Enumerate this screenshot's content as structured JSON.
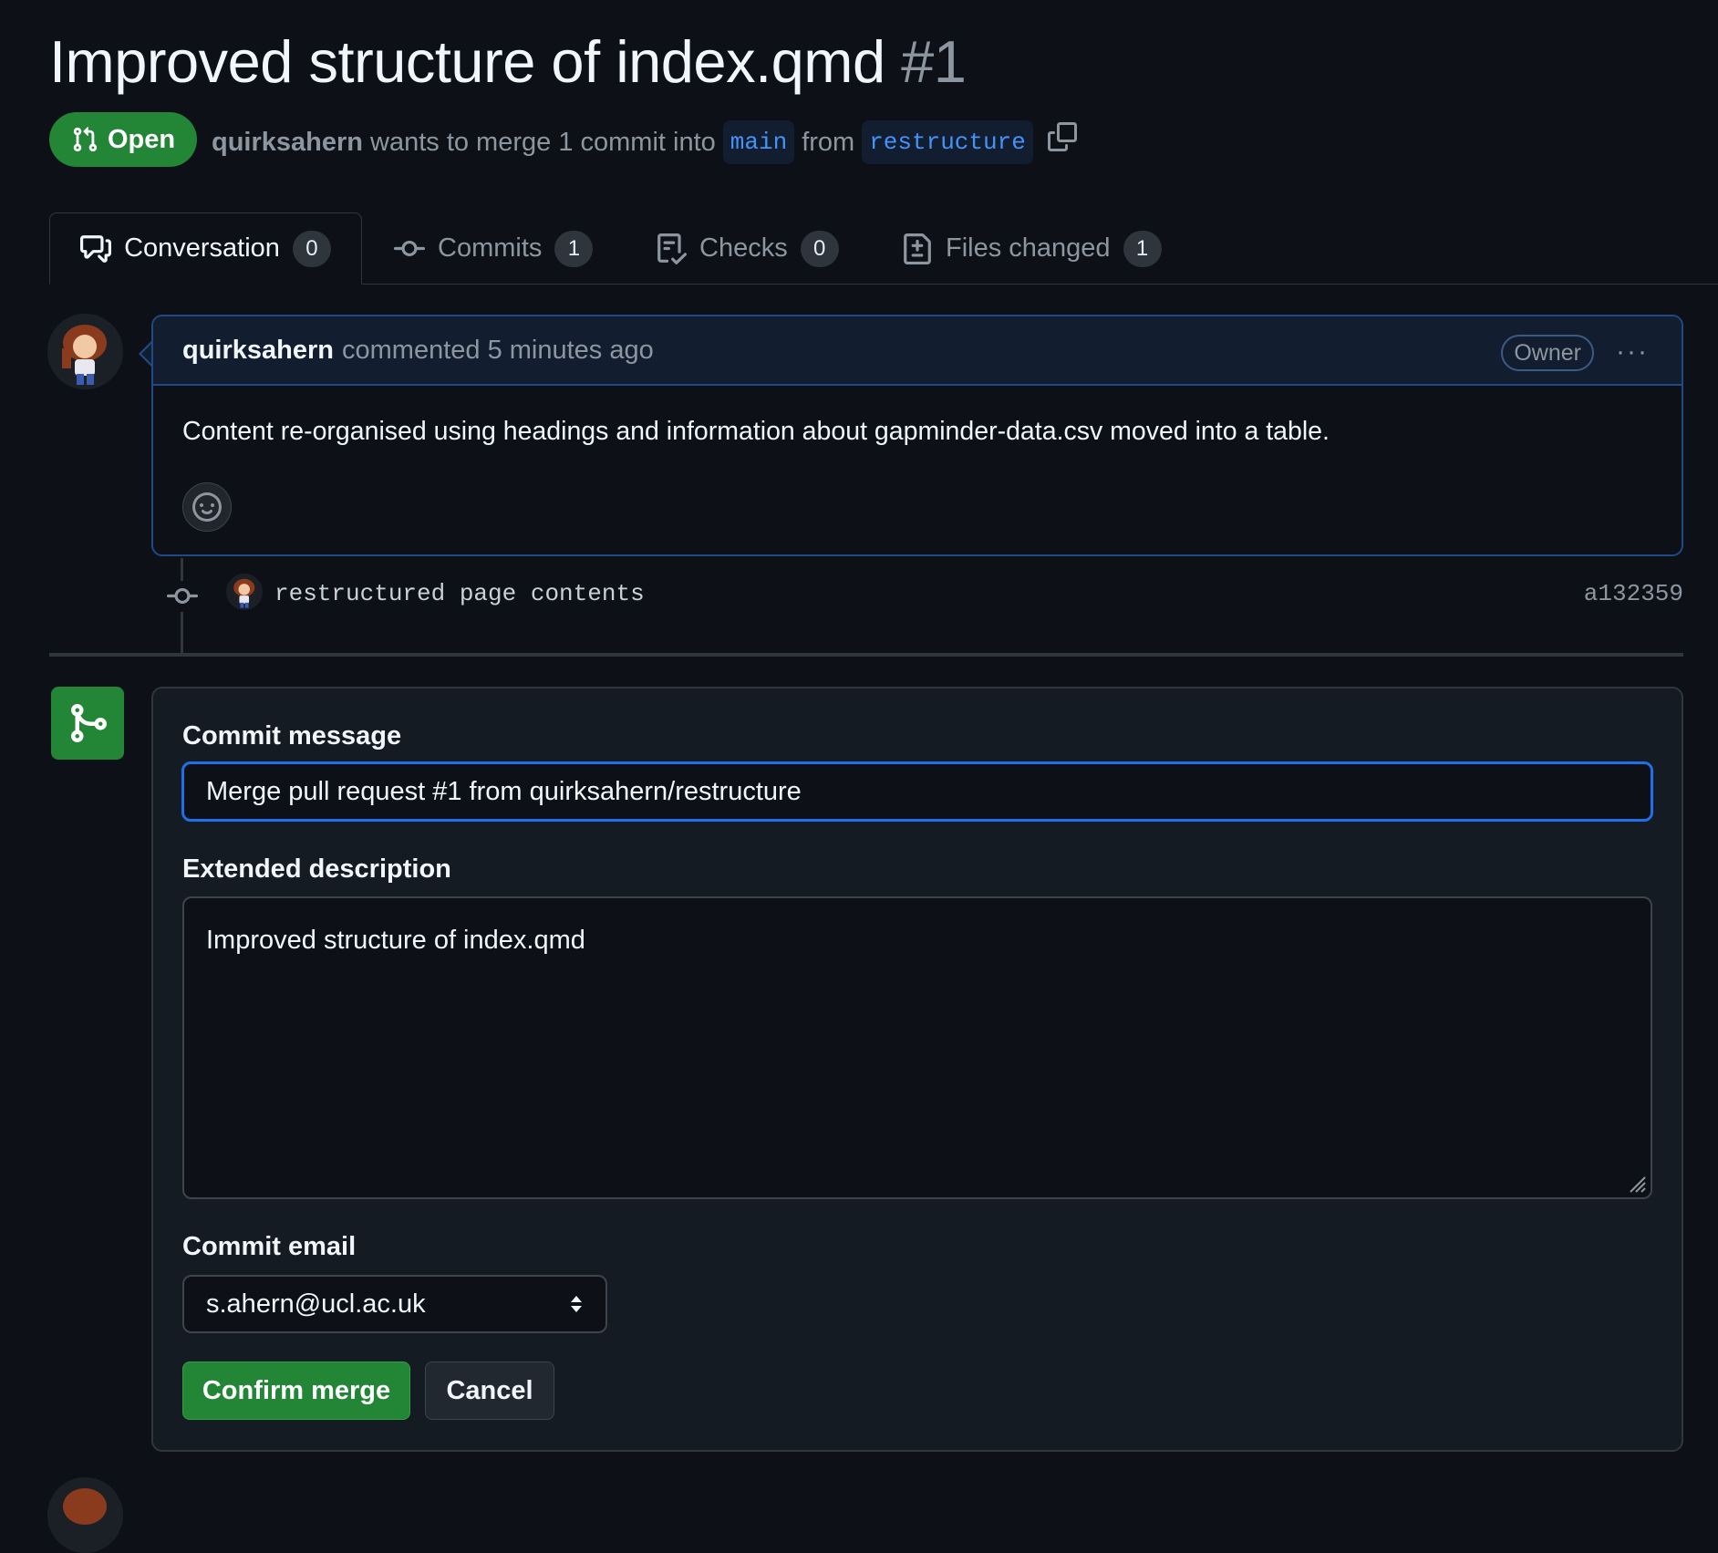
{
  "pr": {
    "title": "Improved structure of index.qmd",
    "number": "#1",
    "state": "Open",
    "author": "quirksahern",
    "meta_text": "wants to merge 1 commit into",
    "base_branch": "main",
    "from_text": "from",
    "head_branch": "restructure"
  },
  "tabs": [
    {
      "label": "Conversation",
      "count": "0",
      "icon": "comment-discussion-icon"
    },
    {
      "label": "Commits",
      "count": "1",
      "icon": "git-commit-icon"
    },
    {
      "label": "Checks",
      "count": "0",
      "icon": "checklist-icon"
    },
    {
      "label": "Files changed",
      "count": "1",
      "icon": "file-diff-icon"
    }
  ],
  "comment": {
    "author": "quirksahern",
    "action": "commented 5 minutes ago",
    "badge": "Owner",
    "more": "···",
    "body": "Content re-organised using headings and information about gapminder-data.csv moved into a table."
  },
  "commit": {
    "message": "restructured page contents",
    "sha": "a132359"
  },
  "merge_form": {
    "commit_message_label": "Commit message",
    "commit_message_value": "Merge pull request #1 from quirksahern/restructure",
    "extended_description_label": "Extended description",
    "extended_description_value": "Improved structure of index.qmd",
    "commit_email_label": "Commit email",
    "commit_email_value": "s.ahern@ucl.ac.uk",
    "confirm_label": "Confirm merge",
    "cancel_label": "Cancel"
  },
  "colors": {
    "background": "#0d1117",
    "accent_green": "#238636",
    "accent_blue": "#1f6feb",
    "link_blue": "#4493f8"
  }
}
